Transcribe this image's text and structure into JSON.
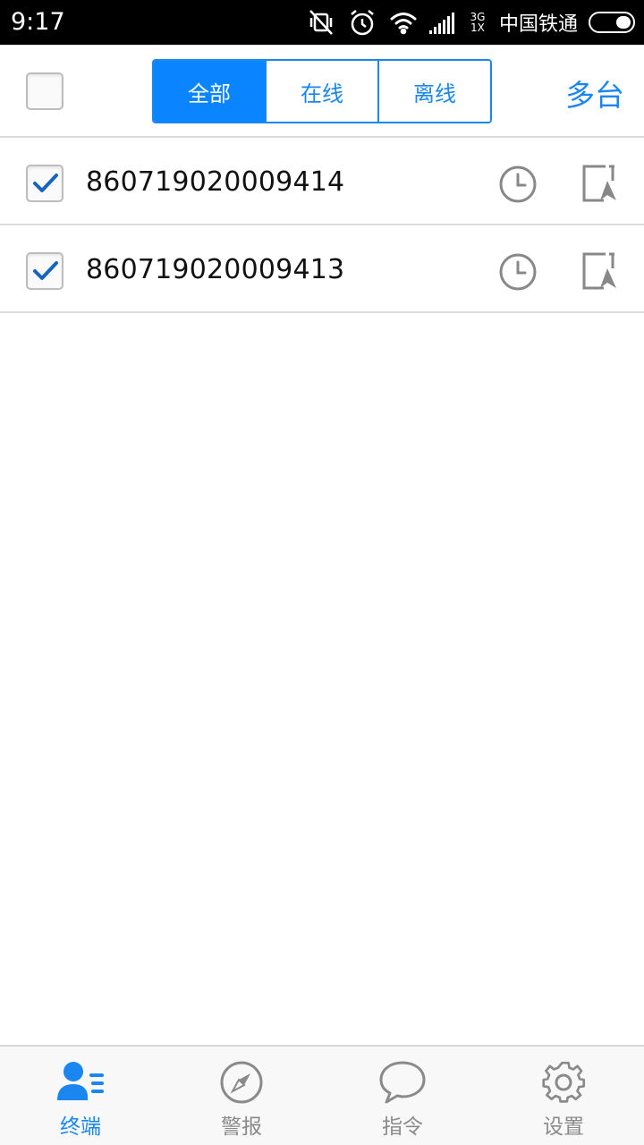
{
  "status_bar": {
    "time": "9:17",
    "network_top": "3G",
    "network_bottom": "1X",
    "carrier": "中国铁通"
  },
  "header": {
    "select_all_checked": false,
    "segments": [
      {
        "label": "全部",
        "active": true
      },
      {
        "label": "在线",
        "active": false
      },
      {
        "label": "离线",
        "active": false
      }
    ],
    "multi_label": "多台"
  },
  "devices": [
    {
      "id": "860719020009414",
      "checked": true,
      "clock_icon": "clock-icon",
      "nav_icon": "navigation-map-icon"
    },
    {
      "id": "860719020009413",
      "checked": true,
      "clock_icon": "clock-icon",
      "nav_icon": "navigation-map-icon"
    }
  ],
  "bottom_nav": [
    {
      "label": "终端",
      "icon": "terminal-user-icon",
      "active": true
    },
    {
      "label": "警报",
      "icon": "compass-icon",
      "active": false
    },
    {
      "label": "指令",
      "icon": "chat-bubble-icon",
      "active": false
    },
    {
      "label": "设置",
      "icon": "gear-icon",
      "active": false
    }
  ],
  "colors": {
    "accent": "#1a86f0",
    "active_segment": "#0a84ff",
    "inactive_icon": "#8a8a8a",
    "check_mark": "#1565c0"
  }
}
